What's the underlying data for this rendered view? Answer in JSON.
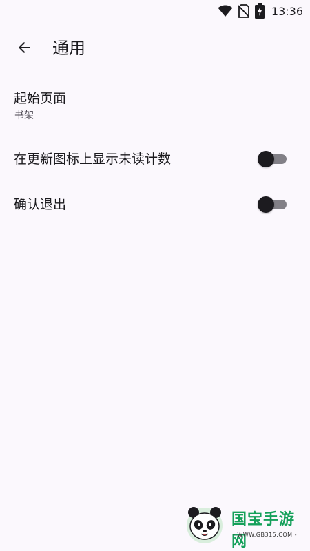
{
  "status_bar": {
    "time": "13:36",
    "icons": [
      "wifi-icon",
      "no-sim-icon",
      "battery-charging-icon"
    ]
  },
  "app_bar": {
    "back_icon": "arrow-back-icon",
    "title": "通用"
  },
  "preferences": [
    {
      "title": "起始页面",
      "summary": "书架"
    },
    {
      "title": "在更新图标上显示未读计数",
      "switch_on": false
    },
    {
      "title": "确认退出",
      "switch_on": false
    }
  ],
  "watermark": {
    "text": "国宝手游网",
    "url": "- WWW.GB315.COM -"
  },
  "colors": {
    "background": "#fbf8fd",
    "text_primary": "#1c1b1f",
    "text_secondary": "#49454f",
    "switch_track_off": "#828087",
    "switch_thumb_off": "#1c1b1f",
    "watermark_green": "#15a05a"
  }
}
